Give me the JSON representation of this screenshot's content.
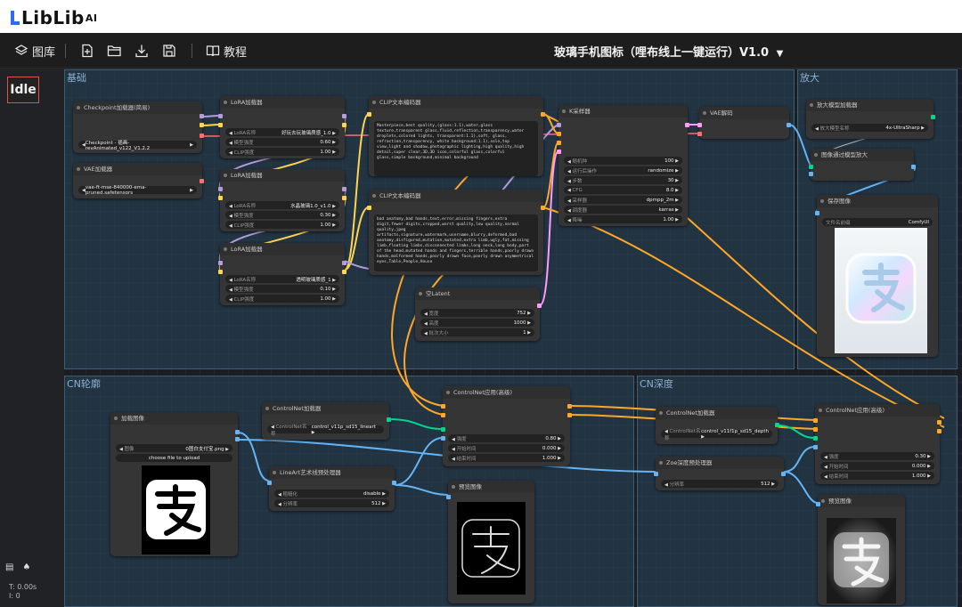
{
  "brand": {
    "name": "LibLib",
    "suffix": "AI"
  },
  "toolbar": {
    "gallery_label": "图库",
    "tutorial_label": "教程",
    "workflow_title": "玻璃手机图标（哩布线上一键运行）V1.0"
  },
  "status": {
    "queue": "Idle",
    "time": "T: 0.00s",
    "count": "I: 0"
  },
  "groups": {
    "base": "基础",
    "upscale": "放大",
    "cn_outline": "CN轮廓",
    "cn_depth": "CN深度"
  },
  "nodes": {
    "checkpoint": {
      "title": "Checkpoint加载器(简易)",
      "value": "Checkpoint - 插画-revAnimated_v122_V1.2.2"
    },
    "vae": {
      "title": "VAE加载器",
      "value": "vae-ft-mse-840000-ema-pruned.safetensors"
    },
    "lora1": {
      "title": "LoRA加载器",
      "name_label": "LoRA名称",
      "name_value": "好玩去玩玻璃质感_1.0",
      "model_label": "模型强度",
      "model_value": "0.60",
      "clip_label": "CLIP强度",
      "clip_value": "1.00"
    },
    "lora2": {
      "title": "LoRA加载器",
      "name_label": "LoRA名称",
      "name_value": "水晶玻璃1.0_v1.0",
      "model_label": "模型强度",
      "model_value": "0.30",
      "clip_label": "CLIP强度",
      "clip_value": "1.00"
    },
    "lora3": {
      "title": "LoRA加载器",
      "name_label": "LoRA名称",
      "name_value": "透明玻璃质感_1",
      "model_label": "模型强度",
      "model_value": "0.10",
      "clip_label": "CLIP强度",
      "clip_value": "1.00"
    },
    "clip_pos": {
      "title": "CLIP文本编码器",
      "text": "Masterpiece,best quality,(glass:1.1),water,glass texture,transparent glass,fluid,reflection,transparency,water droplets,colored lights, transparent:1.1),soft, glass, refraction,transparency, white background:1.1),solo,top view,light and shadow,photographic lighting,high quality,high detail,super clear,3D,3D icon,colorful glass,colorful glass,simple background,minimal background"
    },
    "clip_neg": {
      "title": "CLIP文本编码器",
      "text": "bad anatomy,bad hands,text,error,missing fingers,extra digit,fewer digits,cropped,worst quality,low quality,normal quality,jpeg artifacts,signature,watermark,username,blurry,deformed,bad anatomy,disfigured,mutation,mutated,extra limb,ugly,fat,missing limb,floating limbs,disconnected limbs,long neck,long body,part of the head,mutated hands and fingers,terrible hands,poorly drawn hands,malformed hands,poorly drawn face,poorly drawn asymmetrical eyes,Table,People,House"
    },
    "ksampler": {
      "title": "K采样器",
      "rows": [
        {
          "label": "随机种",
          "value": "100"
        },
        {
          "label": "运行后操作",
          "value": "randomize"
        },
        {
          "label": "步数",
          "value": "30"
        },
        {
          "label": "CFG",
          "value": "8.0"
        },
        {
          "label": "采样器",
          "value": "dpmpp_2m"
        },
        {
          "label": "调度器",
          "value": "karras"
        },
        {
          "label": "降噪",
          "value": "1.00"
        }
      ]
    },
    "vae_decode": {
      "title": "VAE解码"
    },
    "upscale_loader": {
      "title": "放大模型加载器",
      "label": "放大模型名称",
      "value": "4x-UltraSharp"
    },
    "upscale_apply": {
      "title": "图像通过模型放大"
    },
    "save_image": {
      "title": "保存图像",
      "label": "文件名前缀",
      "value": "ComfyUI"
    },
    "latent": {
      "title": "空Latent",
      "rows": [
        {
          "label": "宽度",
          "value": "752"
        },
        {
          "label": "高度",
          "value": "1000"
        },
        {
          "label": "批次大小",
          "value": "1"
        }
      ]
    },
    "load_image": {
      "title": "加载图像",
      "label": "图像",
      "value": "0图白支付宝.png",
      "upload": "choose file to upload"
    },
    "cn_loader1": {
      "title": "ControlNet加载器",
      "label": "ControlNet名称",
      "value": "control_v11p_sd15_lineart"
    },
    "cn_apply1": {
      "title": "ControlNet应用(高级)",
      "rows": [
        {
          "label": "强度",
          "value": "0.80"
        },
        {
          "label": "开始时间",
          "value": "0.000"
        },
        {
          "label": "结束时间",
          "value": "1.000"
        }
      ]
    },
    "lineart": {
      "title": "LineArt艺术线预处理器",
      "rows": [
        {
          "label": "粗糙化",
          "value": "disable"
        },
        {
          "label": "分辨率",
          "value": "512"
        }
      ]
    },
    "preview1": {
      "title": "预览图像"
    },
    "cn_loader2": {
      "title": "ControlNet加载器",
      "label": "ControlNet名称",
      "value": "control_v11f1p_sd15_depth"
    },
    "zoe": {
      "title": "Zoe深度预处理器",
      "label": "分辨率",
      "value": "512"
    },
    "cn_apply2": {
      "title": "ControlNet应用(高级)",
      "rows": [
        {
          "label": "强度",
          "value": "0.30"
        },
        {
          "label": "开始时间",
          "value": "0.000"
        },
        {
          "label": "结束时间",
          "value": "1.000"
        }
      ]
    },
    "preview2": {
      "title": "预览图像"
    }
  },
  "colors": {
    "accent_blue": "#2b6ef5",
    "model_link": "#b39ddb",
    "clip_link": "#ffd54f",
    "cond_link": "#ffa726",
    "image_link": "#64b5f6",
    "latent_link": "#ff9cf9",
    "cn_link": "#00d78d",
    "vae_link": "#ff6e6e"
  }
}
